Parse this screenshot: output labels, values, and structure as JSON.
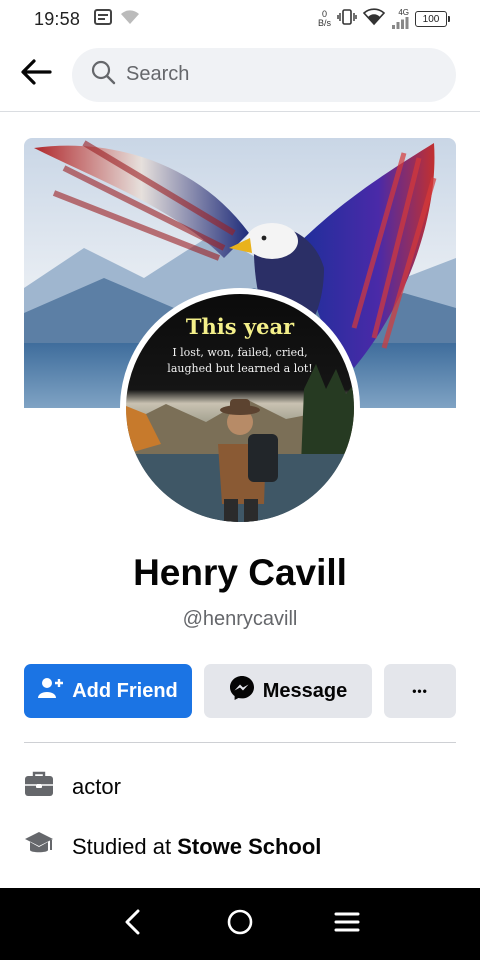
{
  "status_bar": {
    "time": "19:58",
    "net_speed_value": "0",
    "net_speed_unit": "B/s",
    "network_type": "4G",
    "battery": "100"
  },
  "search": {
    "placeholder": "Search"
  },
  "profile": {
    "avatar_title": "This year",
    "avatar_line1": "I lost, won, failed, cried,",
    "avatar_line2": "laughed but learned a lot!",
    "name": "Henry Cavill",
    "username": "@henrycavill"
  },
  "actions": {
    "add_friend": "Add Friend",
    "message": "Message",
    "more": "•••"
  },
  "info": {
    "occupation": "actor",
    "education_prefix": "Studied at ",
    "education_school": "Stowe School"
  },
  "icons": [
    "back-arrow-icon",
    "search-icon",
    "add-person-icon",
    "messenger-icon",
    "briefcase-icon",
    "graduation-cap-icon",
    "nav-back-icon",
    "nav-home-icon",
    "nav-menu-icon"
  ],
  "colors": {
    "primary": "#1b74e4",
    "secondary_button": "#e4e6eb",
    "search_bg": "#f0f2f5"
  }
}
